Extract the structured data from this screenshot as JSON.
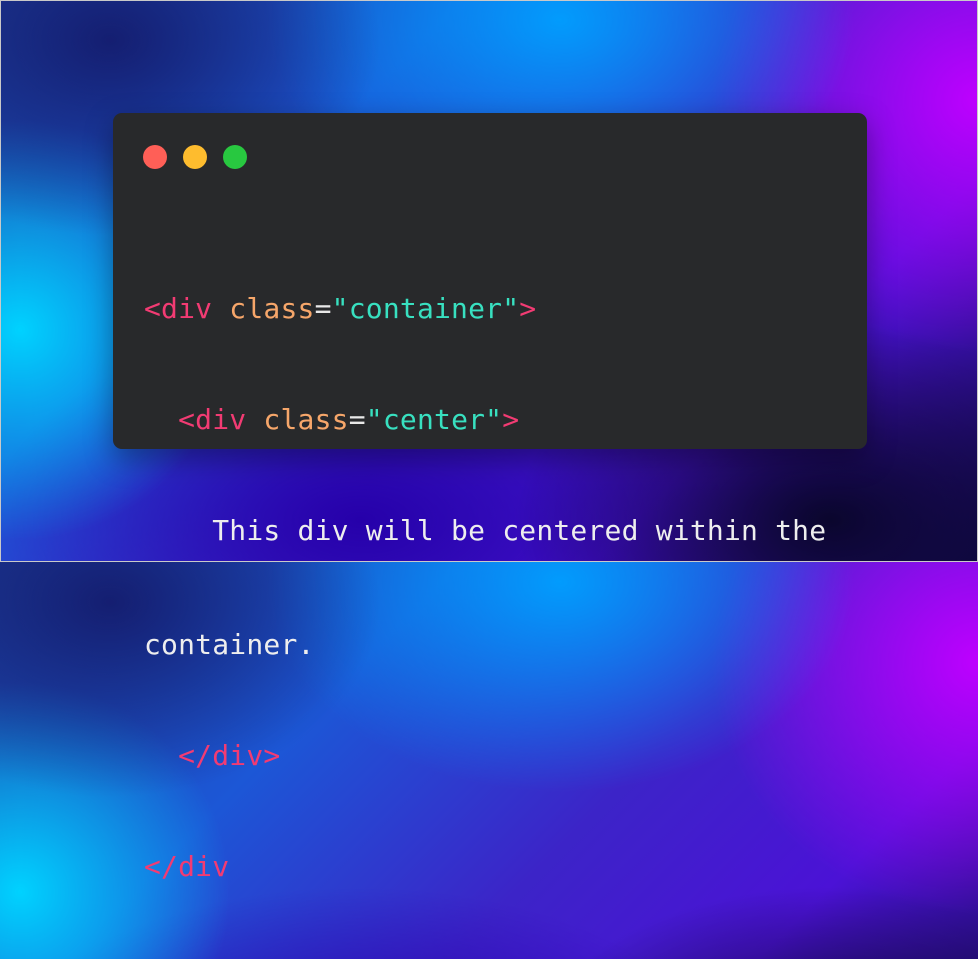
{
  "window": {
    "controls": [
      "close",
      "minimize",
      "maximize"
    ],
    "colors": {
      "close": "#ff5f57",
      "minimize": "#febc2e",
      "maximize": "#28c840",
      "background": "#28292b"
    }
  },
  "code": {
    "line1": {
      "indent": "",
      "tag_open": "<div",
      "space": " ",
      "attr": "class",
      "eq": "=",
      "value": "\"container\"",
      "tag_close": ">"
    },
    "line2": {
      "indent": "  ",
      "tag_open": "<div",
      "space": " ",
      "attr": "class",
      "eq": "=",
      "value": "\"center\"",
      "tag_close": ">"
    },
    "line3": {
      "text": "    This div will be centered within the"
    },
    "line4": {
      "text": "container."
    },
    "line5": {
      "indent": "  ",
      "tag": "</div>"
    },
    "line6": {
      "tag": "</div"
    }
  },
  "syntax_colors": {
    "tag": "#f23b73",
    "attribute": "#f6a66a",
    "string": "#38e0c0",
    "text": "#eeeeee"
  }
}
